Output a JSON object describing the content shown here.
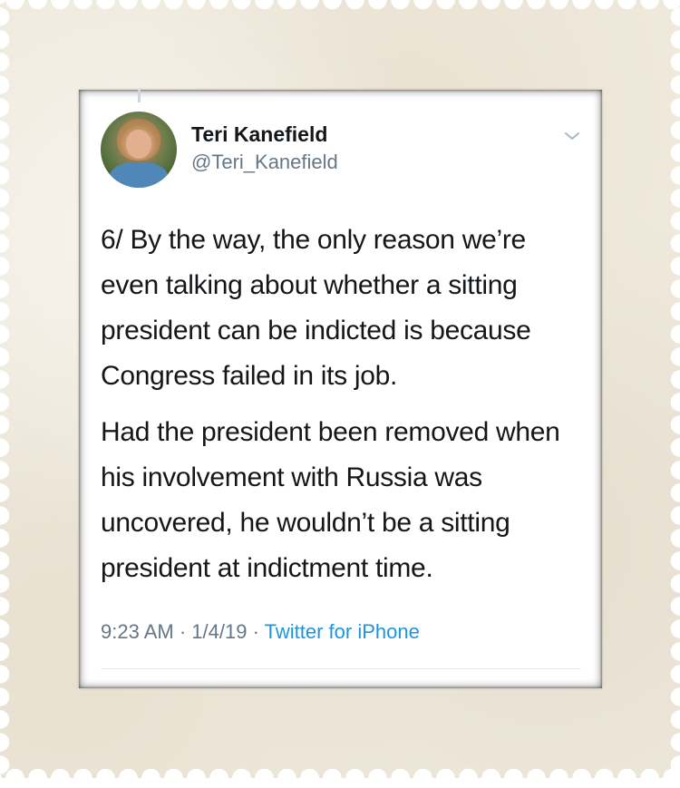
{
  "tweet": {
    "author": {
      "name": "Teri Kanefield",
      "handle": "@Teri_Kanefield",
      "avatar_icon": "avatar-photo"
    },
    "paragraphs": [
      "6/ By the way, the only reason we’re even talking about whether a sitting president can be indicted is because Congress failed in its job.",
      "Had the president been removed when his involvement with Russia was uncovered, he wouldn’t be a sitting president at indictment time."
    ],
    "time": "9:23 AM",
    "date": "1/4/19",
    "separator": "·",
    "source": "Twitter for iPhone",
    "menu_icon": "chevron-down-icon"
  },
  "colors": {
    "text": "#14171a",
    "secondary": "#657786",
    "link": "#1b95e0",
    "stamp_background": "#efe9dc"
  }
}
